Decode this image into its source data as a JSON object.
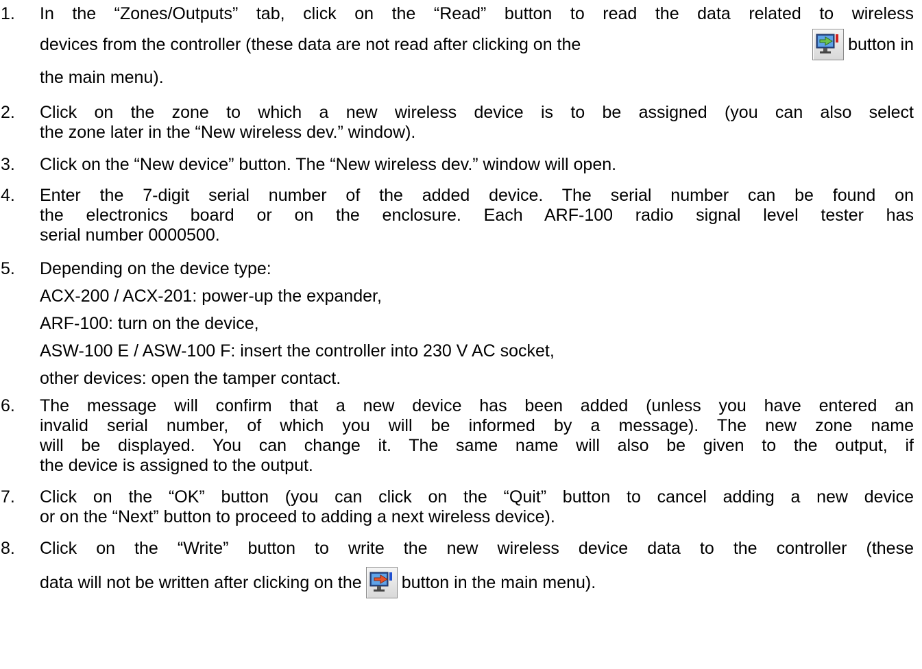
{
  "steps": [
    {
      "num": "1.",
      "lines": [
        "In the “Zones/Outputs” tab, click on the “Read” button to read the data related to wireless",
        "devices from the controller (these data are not read after clicking on the",
        "button in",
        "the main menu)."
      ]
    },
    {
      "num": "2.",
      "lines": [
        "Click on the zone to which a new wireless device is to be assigned (you can also select",
        "the zone later in the “New wireless dev.” window)."
      ]
    },
    {
      "num": "3.",
      "lines": [
        "Click on the “New device” button. The “New wireless dev.” window will open."
      ]
    },
    {
      "num": "4.",
      "lines": [
        "Enter the 7-digit serial number of the added device. The serial number can be found on",
        "the electronics board or on the enclosure. Each ARF-100 radio signal level tester has",
        "serial number 0000500."
      ]
    },
    {
      "num": "5.",
      "lines": [
        "Depending on the device type:",
        "ACX-200 / ACX-201: power-up the expander,",
        "ARF-100: turn on the device,",
        "ASW-100 E / ASW-100 F: insert the controller into 230 V AC socket,",
        "other devices: open the tamper contact."
      ]
    },
    {
      "num": "6.",
      "lines": [
        "The message will confirm that a new device has been added (unless you have entered an",
        "invalid serial number, of which you will be informed by a message). The new zone name",
        "will be displayed. You can change it. The same name will also be given to the output, if",
        "the device is assigned to the output."
      ]
    },
    {
      "num": "7.",
      "lines": [
        "Click on the “OK” button (you can click on the “Quit” button to cancel adding a new device",
        "or on the “Next” button to proceed to adding a next wireless device)."
      ]
    },
    {
      "num": "8.",
      "lines": [
        "Click on the “Write” button to write the new wireless device data to the controller (these",
        "data will not be written after clicking on the",
        "button in the main menu)."
      ]
    }
  ],
  "icons": {
    "read": "read-from-controller-icon",
    "write": "write-to-controller-icon"
  }
}
